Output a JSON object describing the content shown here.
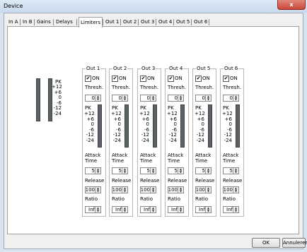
{
  "window": {
    "title": "Device",
    "close_glyph": "x"
  },
  "tabs": [
    "In A",
    "In B",
    "Gains",
    "Delays",
    "Limiters",
    "Out 1",
    "Out 2",
    "Out 3",
    "Out 4",
    "Out 5",
    "Out 6"
  ],
  "active_tab": "Limiters",
  "left_meter": {
    "pk_label": "PK",
    "scale": [
      "+12",
      "+6",
      "0",
      "-6",
      "-12",
      "-24"
    ]
  },
  "labels": {
    "on": "ON",
    "thresh": "Thresh.",
    "pk": "PK",
    "attack_time": "Attack Time",
    "release": "Release",
    "ratio": "Ratio"
  },
  "scale": [
    "+12",
    "+6",
    "0",
    "-6",
    "-12",
    "-24"
  ],
  "outputs": [
    {
      "name": "Out 1",
      "on_checked": "✔",
      "thresh": "0",
      "attack": "5",
      "release": "100",
      "ratio": "Inf"
    },
    {
      "name": "Out 2",
      "on_checked": "✔",
      "thresh": "0",
      "attack": "5",
      "release": "100",
      "ratio": "Inf"
    },
    {
      "name": "Out 3",
      "on_checked": "✔",
      "thresh": "0",
      "attack": "5",
      "release": "100",
      "ratio": "Inf"
    },
    {
      "name": "Out 4",
      "on_checked": "✔",
      "thresh": "0",
      "attack": "5",
      "release": "100",
      "ratio": "Inf"
    },
    {
      "name": "Out 5",
      "on_checked": "✔",
      "thresh": "0",
      "attack": "5",
      "release": "100",
      "ratio": "Inf"
    },
    {
      "name": "Out 6",
      "on_checked": "✔",
      "thresh": "0",
      "attack": "5",
      "release": "100",
      "ratio": "Inf"
    }
  ],
  "buttons": {
    "ok": "OK",
    "cancel": "Annuleren"
  }
}
